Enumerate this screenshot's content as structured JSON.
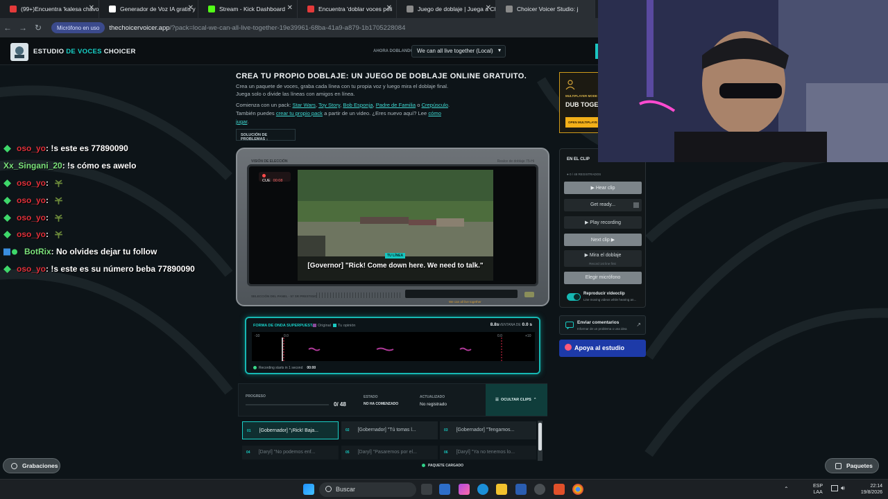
{
  "browser": {
    "tabs": [
      {
        "label": "(99+)Encuentra 'kalesa chavo",
        "color": "#e43a3a"
      },
      {
        "label": "Generador de Voz IA gratis y",
        "color": "#ffffff"
      },
      {
        "label": "Stream - Kick Dashboard",
        "color": "#53fc18"
      },
      {
        "label": "Encuentra 'doblar voces peli",
        "color": "#e43a3a"
      },
      {
        "label": "Juego de doblaje | Juega a Ch",
        "color": "#8a8a8a"
      },
      {
        "label": "Choicer Voicer Studio: j",
        "color": "#8a8a8a"
      }
    ],
    "mic_pill": "Micrófono en uso",
    "url_host": "thechoicervoicer.app",
    "url_rest": "/?pack=local-we-can-all-live-together-19e39961-68ba-41a9-a879-1b1705228084"
  },
  "site": {
    "brand_a": "ESTUDIO ",
    "brand_b": "DE VOCES",
    "brand_c": " CHOICER",
    "now_dubbing_label": "AHORA DOBLANDO",
    "pack_select_value": "We can all live together (Local)",
    "hero_title": "Crea tu propio doblaje: un juego de doblaje online gratuito.",
    "para1": "Crea un paquete de voces, graba cada línea con tu propia voz y luego mira el doblaje final.",
    "para2": "Juega solo o divide las líneas con amigos en línea.",
    "para3_pre": "Comienza con un pack: ",
    "packs": [
      "Star Wars",
      "Toy Story",
      "Bob Esponja",
      "Padre de Familia"
    ],
    "pack_or": " o ",
    "pack_last": "Crepúsculo",
    "para4_pre": "También puedes ",
    "para4_link": "crear tu propio pack",
    "para4_mid": " a partir de un video. ¿Eres nuevo aquí? Lee ",
    "para4_link2": "cómo",
    "para5_link": "jugar",
    "trouble_btn": "SOLUCIÓN DE PROBLEMAS  ↓"
  },
  "chat": [
    {
      "user": "oso_yo",
      "msg": " : !s este es 77890090",
      "ucolor": "#e0303a",
      "icon": "gem",
      "leaf": false
    },
    {
      "user": "Xx_Singani_20",
      "msg": " : !s cómo es awelo",
      "ucolor": "#7be27b",
      "icon": "none",
      "leaf": false
    },
    {
      "user": "oso_yo",
      "msg": " :",
      "ucolor": "#e0303a",
      "icon": "gem",
      "leaf": true
    },
    {
      "user": "oso_yo",
      "msg": " :",
      "ucolor": "#e0303a",
      "icon": "gem",
      "leaf": true
    },
    {
      "user": "oso_yo",
      "msg": " :",
      "ucolor": "#e0303a",
      "icon": "gem",
      "leaf": true
    },
    {
      "user": "oso_yo",
      "msg": " :",
      "ucolor": "#e0303a",
      "icon": "gem",
      "leaf": true
    },
    {
      "user": "BotRix",
      "msg": " : No olvides dejar tu follow",
      "ucolor": "#7be27b",
      "icon": "bot",
      "leaf": false
    },
    {
      "user": "oso_yo",
      "msg": " : !s este es su número beba 77890090",
      "ucolor": "#e0303a",
      "icon": "gem",
      "leaf": false
    }
  ],
  "tv": {
    "label_left": "VISIÓN DE ELECCIÓN",
    "label_right": "Realce de doblaje 75-Hi",
    "rec_label": "CUE",
    "rec_time": "00:08",
    "tu_linea": "TU LÍNEA",
    "subtitle": "[Governor] \"Rick! Come down here. We need to talk.\"",
    "bottom_left": "SELECCIÓN DEL PANEL · 57 SR PRESTIGIO",
    "marquee": "We can all live together"
  },
  "wave": {
    "title": "FORMA DE ONDA SUPERPUESTA",
    "legend_original": "Original",
    "legend_yours": "Tu opinión",
    "time_main": "8.8s",
    "time_window_label": "VENTANA DE",
    "time_window": "0.0 s",
    "ticks": [
      "-10",
      "0.0",
      "0.0",
      "+10"
    ],
    "status": "Recording starts in 1 second",
    "status_time": "00:00",
    "colors": {
      "original": "#8a4a9a",
      "yours": "#19c9c1",
      "accent": "#16b8b3"
    }
  },
  "progress": {
    "label": "PROGRESO",
    "count": "0/ 48",
    "state_label": "ESTADO",
    "state_value": "NO HA COMENZADO",
    "updated_label": "ACTUALIZADO",
    "updated_value": "No registrado",
    "hide_clips": "OCULTAR CLIPS"
  },
  "clips": [
    {
      "n": "01",
      "text": "[Gobernador] \"¡Rick! Baja...",
      "state": "selected"
    },
    {
      "n": "02",
      "text": "[Gobernador] \"Tú tomas l...",
      "state": "normal"
    },
    {
      "n": "03",
      "text": "[Gobernador] \"Tengamos...",
      "state": "normal"
    },
    {
      "n": "04",
      "text": "[Daryl] \"No podemos enf...",
      "state": "dim"
    },
    {
      "n": "05",
      "text": "[Daryl] \"Pasaremos por el...",
      "state": "dim"
    },
    {
      "n": "06",
      "text": "[Daryl] \"Ya no tenemos lo...",
      "state": "dim"
    }
  ],
  "pack_loaded": "PAQUETE CARGADO",
  "promo": {
    "sub": "MULTIPLAYER MODE",
    "title": "DUB TOGE",
    "btn": "OPEN MULTIPLAYE"
  },
  "clip_panel": {
    "title": "EN EL CLIP",
    "sub": "● 0 / 48 REGISTRADOS",
    "hear": "▶ Hear clip",
    "get_ready": "Get ready...",
    "play_recording": "▶ Play recording",
    "next_clip": "Next clip ▶",
    "review": "▶  Mira el doblaje",
    "review_sub": "Record 1st line first",
    "choose_mic": "Elegir micrófono",
    "toggle_label": "Reproducir videoclip",
    "toggle_sub": "Line moving videos while hearing an..."
  },
  "feedback": {
    "title": "Enviar comentarios",
    "sub": "Informar de un problema o una idea"
  },
  "support": "Apoya al estudio",
  "recordings_btn": "Grabaciones",
  "packs_btn": "Paquetes",
  "taskbar": {
    "search": "Buscar",
    "lang1": "ESP",
    "lang2": "LAA",
    "time": "22:14",
    "date": "19/8/2026"
  }
}
